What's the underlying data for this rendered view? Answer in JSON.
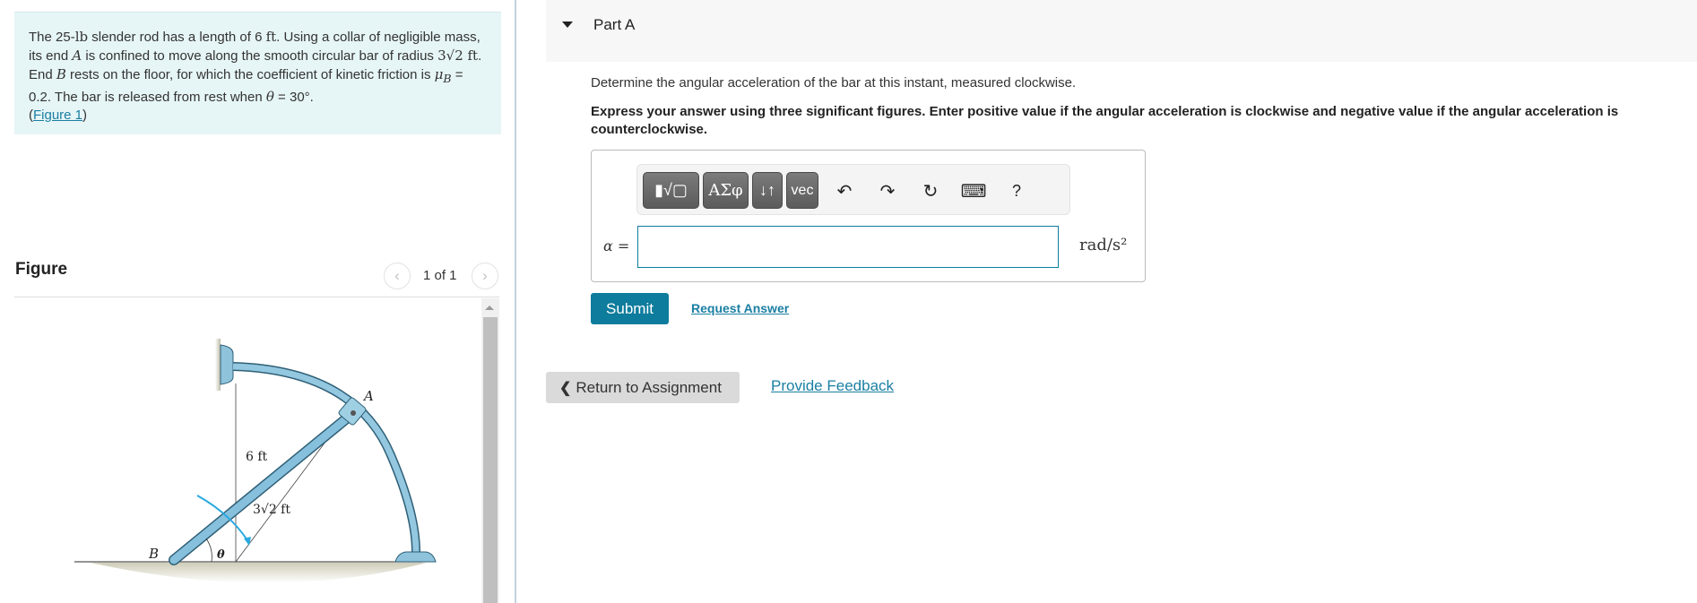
{
  "problem": {
    "text_parts": {
      "p1": "The 25-",
      "unit_lb": "lb",
      "p2": " slender rod has a length of 6 ",
      "unit_ft": "ft",
      "p3": ". Using a collar of negligible mass, its end ",
      "var_A": "A",
      "p4": " is confined to move along the smooth circular bar of radius ",
      "radius": "3√2 ft",
      "p5": ". End ",
      "var_B": "B",
      "p6": " rests on the floor, for which the coefficient of kinetic friction is ",
      "mu": "μ",
      "mu_sub": "B",
      "p7": " = 0.2. The bar is released from rest when ",
      "theta": "θ",
      "p8": " = 30°.",
      "open_paren": "(",
      "figure_link": "Figure 1",
      "close_paren": ")"
    }
  },
  "figure": {
    "heading": "Figure",
    "pager": {
      "label": "1 of 1",
      "prev_icon": "‹",
      "next_icon": "›"
    },
    "labels": {
      "A": "A",
      "B": "B",
      "rod_length": "6 ft",
      "radius": "3√2 ft",
      "theta": "θ"
    },
    "colors": {
      "rod": "#7ab8d6",
      "rod_dark": "#3d7a9a",
      "arrow": "#29a9e0",
      "ground": "#d9d8c8"
    }
  },
  "part": {
    "title": "Part A",
    "question": "Determine the angular acceleration of the bar at this instant, measured clockwise.",
    "instructions": "Express your answer using three significant figures. Enter positive value if the angular acceleration is clockwise and negative value if the angular acceleration is counterclockwise."
  },
  "answer": {
    "toolbar": {
      "templates_label": "▮√▢",
      "symbols_label": "ΑΣφ",
      "arrows_label": "↓↑",
      "vec_label": "vec",
      "undo_icon": "↶",
      "redo_icon": "↷",
      "reset_icon": "↻",
      "keyboard_icon": "⌨",
      "help_icon": "?"
    },
    "variable_label": "α =",
    "input_value": "",
    "units": "rad/s²"
  },
  "actions": {
    "submit": "Submit",
    "request_answer": "Request Answer",
    "return": "Return to Assignment",
    "return_icon": "❮",
    "feedback": "Provide Feedback"
  },
  "colors": {
    "accent": "#0e7c9c",
    "link": "#1a7fa3",
    "problem_bg": "#e6f5f6",
    "header_bg": "#f7f7f7"
  }
}
